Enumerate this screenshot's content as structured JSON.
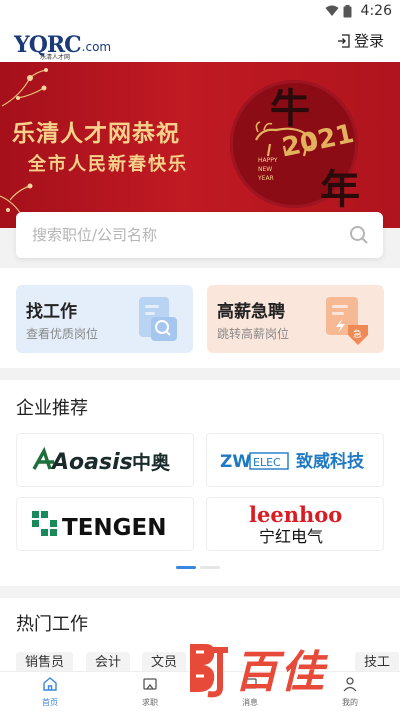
{
  "status_bar": {
    "time": "4:26"
  },
  "header": {
    "logo_mark": "YQRC",
    "logo_com": ".com",
    "logo_sub": "乐清人才网",
    "login_label": "登录"
  },
  "banner": {
    "line1": "乐清人才网恭祝",
    "line2": "全市人民新春快乐",
    "year_char_top": "牛",
    "year_char_bottom": "年",
    "year": "2021",
    "happy_new_year": [
      "HAPPY",
      "NEW",
      "YEAR"
    ]
  },
  "search": {
    "placeholder": "搜索职位/公司名称"
  },
  "quick_cards": [
    {
      "title": "找工作",
      "subtitle": "查看优质岗位"
    },
    {
      "title": "高薪急聘",
      "subtitle": "跳转高薪岗位"
    }
  ],
  "companies": {
    "title": "企业推荐",
    "items": [
      {
        "name": "Aoasis中奥",
        "brand": "Aoasis",
        "suffix": "中奥"
      },
      {
        "name": "ZW ELEC 致威科技",
        "brand": "ZW",
        "mid": "ELEC",
        "suffix": "致威科技"
      },
      {
        "name": "TENGEN",
        "brand": "TENGEN"
      },
      {
        "name": "leenhoo 宁红电气",
        "brand": "leenhoo",
        "suffix": "宁红电气"
      }
    ]
  },
  "hot_jobs": {
    "title": "热门工作",
    "tags": [
      "销售员",
      "会计",
      "文员",
      "技工"
    ]
  },
  "bottom_nav": [
    {
      "label": "首页",
      "active": true
    },
    {
      "label": "求职",
      "active": false
    },
    {
      "label": "消息",
      "active": false
    },
    {
      "label": "我的",
      "active": false
    }
  ],
  "watermark": {
    "text": "百佳"
  },
  "colors": {
    "accent": "#3a86e0",
    "banner_red": "#b8141f",
    "banner_gold": "#f6d28a",
    "watermark_red": "#e84a3a"
  }
}
